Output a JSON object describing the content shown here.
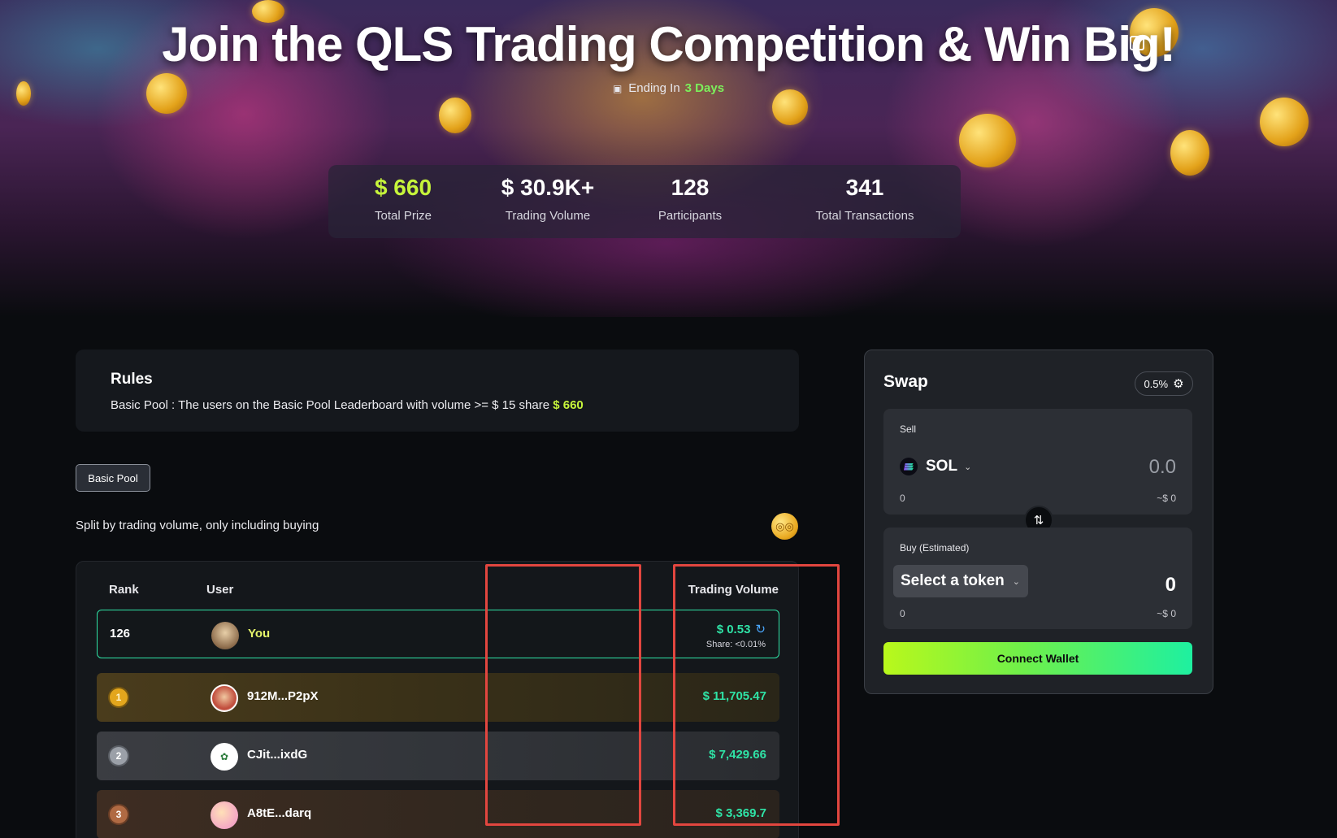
{
  "hero": {
    "title": "Join the QLS Trading Competition & Win Big!",
    "ending_label": "Ending In",
    "ending_value": "3 Days"
  },
  "stats": [
    {
      "value": "$ 660",
      "label": "Total Prize"
    },
    {
      "value": "$ 30.9K+",
      "label": "Trading Volume"
    },
    {
      "value": "128",
      "label": "Participants"
    },
    {
      "value": "341",
      "label": "Total Transactions"
    }
  ],
  "rules": {
    "heading": "Rules",
    "text": "Basic Pool : The users on the Basic Pool Leaderboard with volume >= $ 15 share",
    "prize": "$ 660"
  },
  "pool_tab": "Basic Pool",
  "split_text": "Split by trading volume, only including buying",
  "leaderboard": {
    "headers": {
      "rank": "Rank",
      "user": "User",
      "volume": "Trading Volume"
    },
    "you": {
      "rank": "126",
      "name": "You",
      "volume": "$ 0.53",
      "share": "Share: <0.01%"
    },
    "rows": [
      {
        "rank": "1",
        "name": "912M...P2pX",
        "volume": "$ 11,705.47"
      },
      {
        "rank": "2",
        "name": "CJit...ixdG",
        "volume": "$ 7,429.66"
      },
      {
        "rank": "3",
        "name": "A8tE...darq",
        "volume": "$ 3,369.7"
      }
    ]
  },
  "swap": {
    "title": "Swap",
    "slippage": "0.5%",
    "sell": {
      "label": "Sell",
      "token": "SOL",
      "amount": "0.0",
      "balance": "0",
      "usd": "~$ 0"
    },
    "buy": {
      "label": "Buy (Estimated)",
      "token": "Select a token",
      "amount": "0",
      "balance": "0",
      "usd": "~$ 0"
    },
    "connect": "Connect Wallet"
  },
  "colors": {
    "accent_green": "#2fe3a6",
    "prize_yellow": "#c6f43b",
    "annotation_red": "#e2463f"
  }
}
